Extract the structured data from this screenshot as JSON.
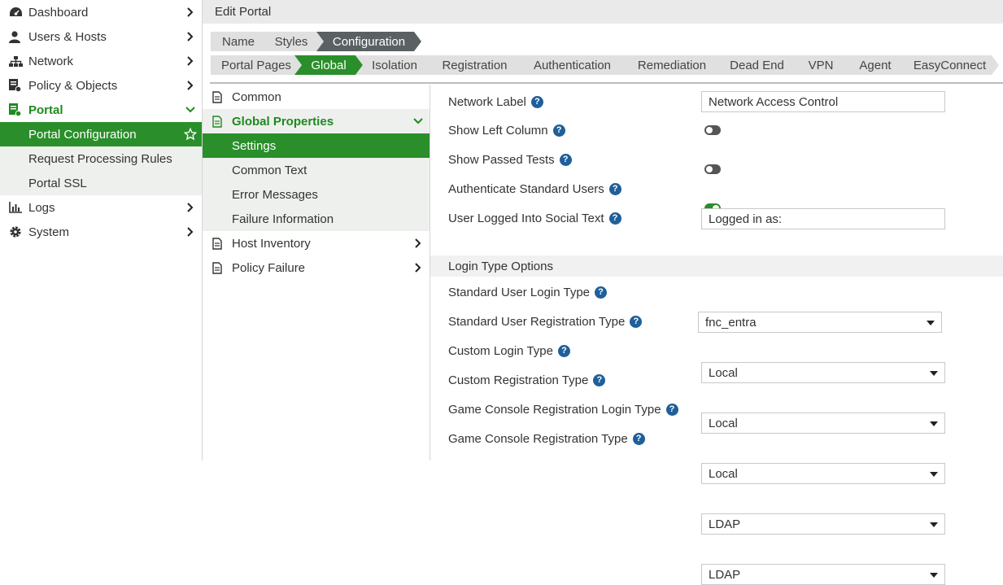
{
  "nav": {
    "items": [
      {
        "label": "Dashboard",
        "icon": "dashboard-icon"
      },
      {
        "label": "Users & Hosts",
        "icon": "user-icon"
      },
      {
        "label": "Network",
        "icon": "network-icon"
      },
      {
        "label": "Policy & Objects",
        "icon": "policy-icon"
      },
      {
        "label": "Portal",
        "icon": "portal-icon"
      },
      {
        "label": "Logs",
        "icon": "logs-icon"
      },
      {
        "label": "System",
        "icon": "gear-icon"
      }
    ],
    "portal_subitems": [
      {
        "label": "Portal Configuration"
      },
      {
        "label": "Request Processing Rules"
      },
      {
        "label": "Portal SSL"
      }
    ]
  },
  "header": {
    "title": "Edit Portal"
  },
  "wizard_steps": [
    "Name",
    "Styles",
    "Configuration"
  ],
  "config_tabs": [
    "Portal Pages",
    "Global",
    "Isolation",
    "Registration",
    "Authentication",
    "Remediation",
    "Dead End",
    "VPN",
    "Agent",
    "EasyConnect"
  ],
  "tree": {
    "common": "Common",
    "global_properties": "Global Properties",
    "global_children": [
      "Settings",
      "Common Text",
      "Error Messages",
      "Failure Information"
    ],
    "host_inventory": "Host Inventory",
    "policy_failure": "Policy Failure"
  },
  "form": {
    "network_label": {
      "label": "Network Label",
      "value": "Network Access Control"
    },
    "show_left_column": {
      "label": "Show Left Column",
      "enabled": false
    },
    "show_passed_tests": {
      "label": "Show Passed Tests",
      "enabled": false
    },
    "authenticate_standard_users": {
      "label": "Authenticate Standard Users",
      "enabled": true
    },
    "user_logged_social_text": {
      "label": "User Logged Into Social Text",
      "value": "Logged in as:"
    },
    "login_section_title": "Login Type Options",
    "standard_user_login_type": {
      "label": "Standard User Login Type",
      "value": "fnc_entra"
    },
    "standard_user_registration_type": {
      "label": "Standard User Registration Type",
      "value": "Local"
    },
    "custom_login_type": {
      "label": "Custom Login Type",
      "value": "Local"
    },
    "custom_registration_type": {
      "label": "Custom Registration Type",
      "value": "Local"
    },
    "game_console_registration_login_type": {
      "label": "Game Console Registration Login Type",
      "value": "LDAP"
    },
    "game_console_registration_type": {
      "label": "Game Console Registration Type",
      "value": "LDAP"
    }
  },
  "colors": {
    "accent_green": "#2a8f2a",
    "help_blue": "#1f5f9a",
    "wizard_dark": "#5b6163"
  }
}
